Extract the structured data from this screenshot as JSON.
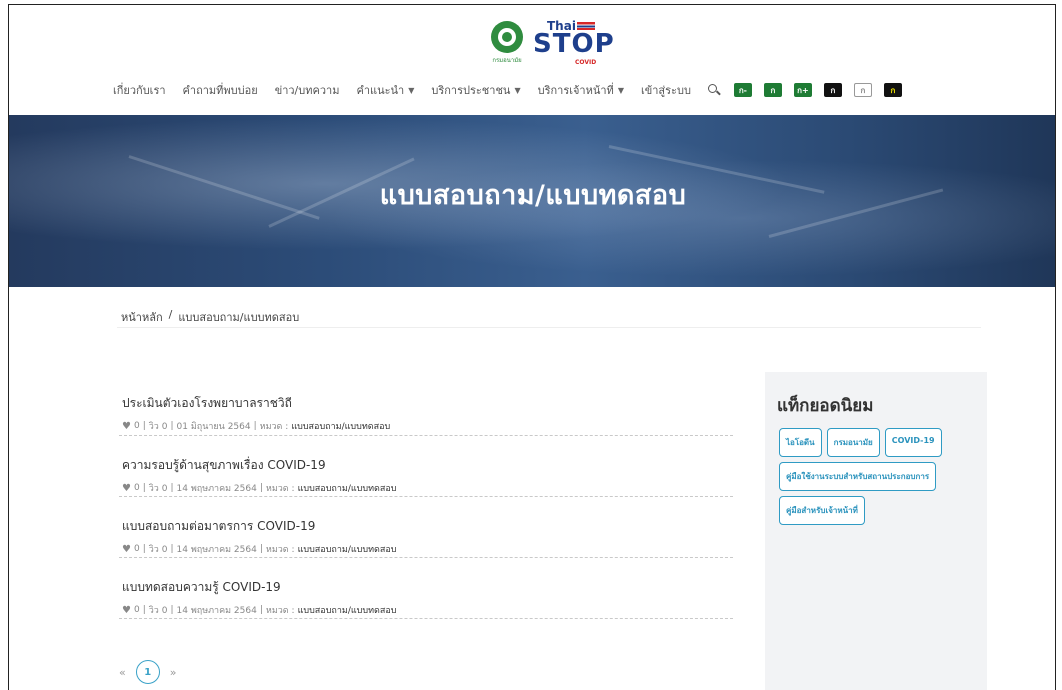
{
  "header": {
    "logo": {
      "top_text": "Thai",
      "main_text": "STOP",
      "sub_text": "COVID",
      "seal_caption": "กรมอนามัย"
    },
    "nav": [
      {
        "label": "เกี่ยวกับเรา",
        "dropdown": false
      },
      {
        "label": "คำถามที่พบบ่อย",
        "dropdown": false
      },
      {
        "label": "ข่าว/บทความ",
        "dropdown": false
      },
      {
        "label": "คำแนะนำ",
        "dropdown": true
      },
      {
        "label": "บริการประชาชน",
        "dropdown": true
      },
      {
        "label": "บริการเจ้าหน้าที่",
        "dropdown": true
      },
      {
        "label": "เข้าสู่ระบบ",
        "dropdown": false
      }
    ],
    "font_buttons": [
      "ก-",
      "ก",
      "ก+",
      "ก",
      "ก",
      "ก"
    ]
  },
  "hero": {
    "title": "แบบสอบถาม/แบบทดสอบ"
  },
  "breadcrumb": {
    "home": "หน้าหลัก",
    "separator": "/",
    "current": "แบบสอบถาม/แบบทดสอบ"
  },
  "articles": [
    {
      "title": "ประเมินตัวเองโรงพยาบาลราชวิถี",
      "likes": "0",
      "views": "วิว 0",
      "date": "01 มิถุนายน 2564",
      "cat_label": "หมวด :",
      "category": "แบบสอบถาม/แบบทดสอบ"
    },
    {
      "title": "ความรอบรู้ด้านสุขภาพเรื่อง COVID-19",
      "likes": "0",
      "views": "วิว 0",
      "date": "14 พฤษภาคม 2564",
      "cat_label": "หมวด :",
      "category": "แบบสอบถาม/แบบทดสอบ"
    },
    {
      "title": "แบบสอบถามต่อมาตรการ COVID-19",
      "likes": "0",
      "views": "วิว 0",
      "date": "14 พฤษภาคม 2564",
      "cat_label": "หมวด :",
      "category": "แบบสอบถาม/แบบทดสอบ"
    },
    {
      "title": "แบบทดสอบความรู้ COVID-19",
      "likes": "0",
      "views": "วิว 0",
      "date": "14 พฤษภาคม 2564",
      "cat_label": "หมวด :",
      "category": "แบบสอบถาม/แบบทดสอบ"
    }
  ],
  "pagination": {
    "prev": "«",
    "current": "1",
    "next": "»"
  },
  "sidebar": {
    "title": "แท็กยอดนิยม",
    "tags": [
      "ไอโอดีน",
      "กรมอนามัย",
      "COVID-19",
      "คู่มือใช้งานระบบสำหรับสถานประกอบการ",
      "คู่มือสำหรับเจ้าหน้าที่"
    ]
  },
  "colors": {
    "brand_blue": "#1e3f8c",
    "brand_green": "#1e7b34",
    "tag_blue": "#2f9bc4",
    "hero_dark": "#243a5e"
  }
}
